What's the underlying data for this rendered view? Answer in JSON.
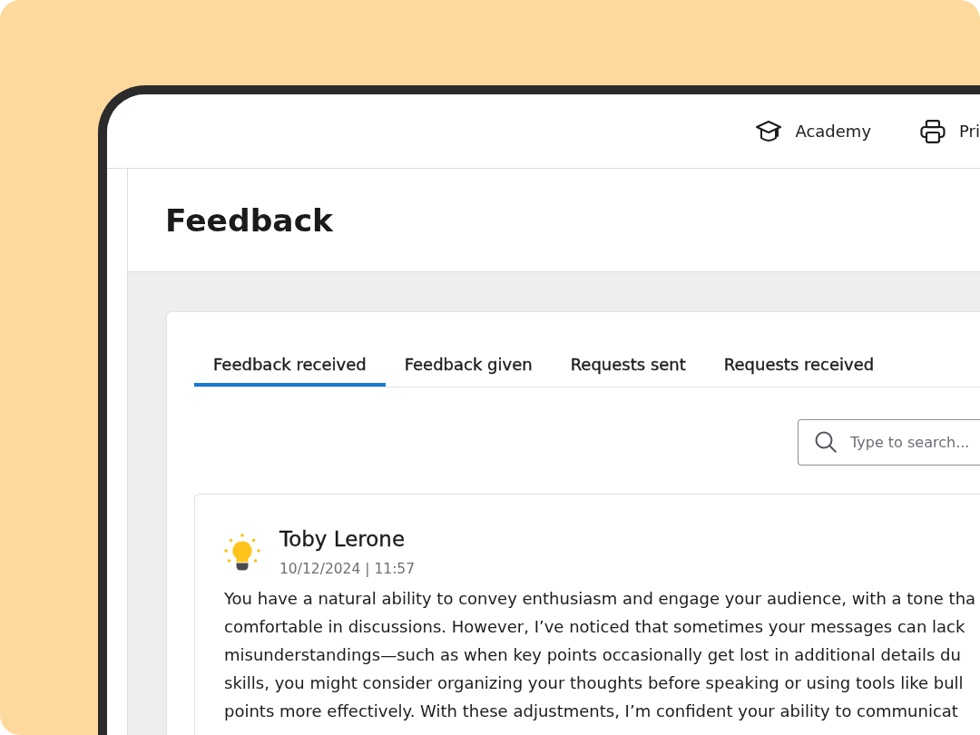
{
  "nav": [
    {
      "kind": "academy",
      "label": "Academy"
    },
    {
      "kind": "print",
      "label": "Pri"
    }
  ],
  "header": {
    "title": "Feedback"
  },
  "tabs": [
    {
      "label": "Feedback received",
      "selected": true
    },
    {
      "label": "Feedback given",
      "selected": false
    },
    {
      "label": "Requests sent",
      "selected": false
    },
    {
      "label": "Requests received",
      "selected": false
    }
  ],
  "search": {
    "placeholder": "Type to search..."
  },
  "feedback": [
    {
      "author": "Toby Lerone",
      "date": "10/12/2024 | 11:57",
      "text_lines": [
        "You have a natural ability to convey enthusiasm and engage your audience, with a tone tha",
        "comfortable in discussions. However, I’ve noticed that sometimes your messages can lack",
        "misunderstandings—such as when key points occasionally get lost in additional details du",
        "skills, you might consider organizing your thoughts before speaking or using tools like bull",
        "points more effectively. With these adjustments, I’m confident your ability to communicat"
      ]
    }
  ]
}
